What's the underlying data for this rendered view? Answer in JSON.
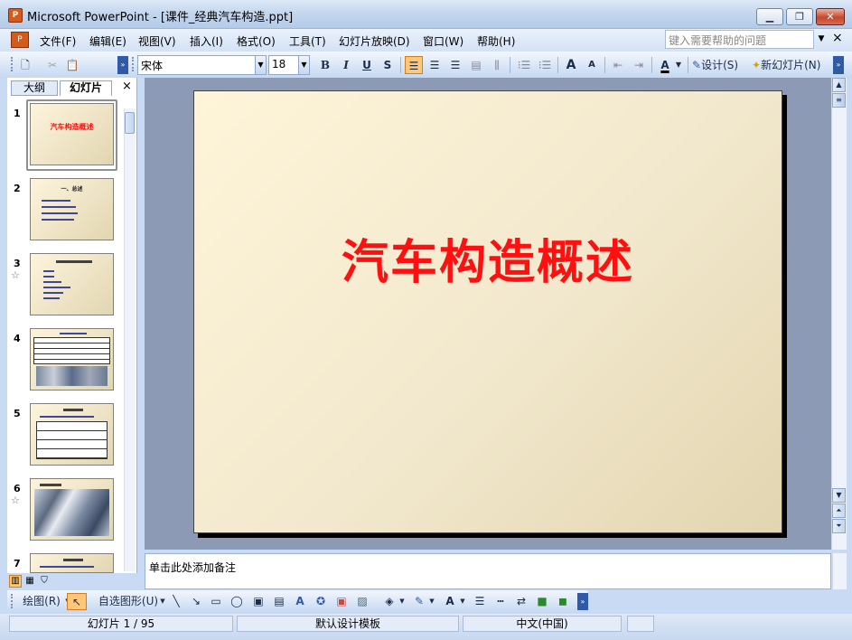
{
  "window": {
    "title": "Microsoft PowerPoint - [课件_经典汽车构造.ppt]",
    "app_icon": "P",
    "minimize": "▁",
    "restore": "❐",
    "close": "✕"
  },
  "menu": {
    "items": [
      "文件(F)",
      "编辑(E)",
      "视图(V)",
      "插入(I)",
      "格式(O)",
      "工具(T)",
      "幻灯片放映(D)",
      "窗口(W)",
      "帮助(H)"
    ],
    "help_placeholder": "键入需要帮助的问题",
    "close": "×"
  },
  "toolbar": {
    "font_name": "宋体",
    "font_size": "18",
    "bold": "B",
    "italic": "I",
    "underline": "U",
    "shadow": "S",
    "grow_font": "A",
    "shrink_font": "A",
    "font_color": "A",
    "design_label": "设计(S)",
    "new_slide_label": "新幻灯片(N)"
  },
  "left_pane": {
    "tabs": [
      "大纲",
      "幻灯片"
    ],
    "close": "×",
    "slides": [
      {
        "num": "1",
        "star": "",
        "title": "汽车构造概述"
      },
      {
        "num": "2",
        "star": "",
        "title": "一、总述"
      },
      {
        "num": "3",
        "star": "☆",
        "title": ""
      },
      {
        "num": "4",
        "star": "",
        "title": ""
      },
      {
        "num": "5",
        "star": "",
        "title": ""
      },
      {
        "num": "6",
        "star": "☆",
        "title": ""
      },
      {
        "num": "7",
        "star": "",
        "title": ""
      }
    ]
  },
  "slide": {
    "title": "汽车构造概述"
  },
  "notes": {
    "placeholder": "单击此处添加备注"
  },
  "drawing": {
    "draw_label": "绘图(R)",
    "autoshapes_label": "自选图形(U)"
  },
  "status": {
    "slide_counter": "幻灯片 1 / 95",
    "template": "默认设计模板",
    "language": "中文(中国)"
  },
  "colors": {
    "title_red": "#ff1010"
  }
}
